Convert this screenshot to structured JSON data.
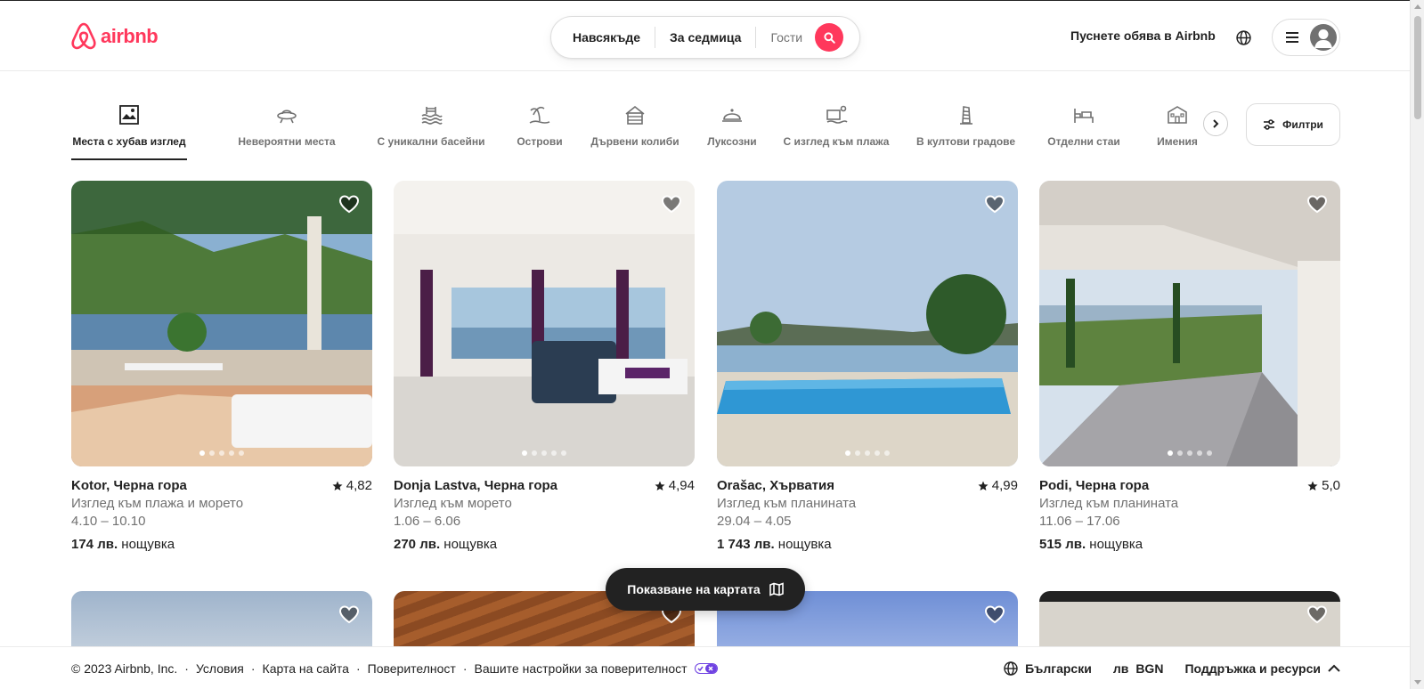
{
  "brand": {
    "name": "airbnb",
    "color": "#ff385c"
  },
  "search": {
    "where": "Навсякъде",
    "when": "За седмица",
    "guests_placeholder": "Гости",
    "button_icon": "search-icon"
  },
  "header": {
    "host_link": "Пуснете обява в Airbnb",
    "globe_icon": "globe-icon",
    "menu_icon": "hamburger-icon",
    "avatar_icon": "user-avatar-icon"
  },
  "categories": [
    {
      "label": "Места с хубав изглед",
      "icon": "picture-frame-icon",
      "active": true
    },
    {
      "label": "Невероятни места",
      "icon": "ufo-icon",
      "active": false
    },
    {
      "label": "С уникални басейни",
      "icon": "pool-icon",
      "active": false
    },
    {
      "label": "Острови",
      "icon": "island-icon",
      "active": false
    },
    {
      "label": "Дървени колиби",
      "icon": "cabin-icon",
      "active": false
    },
    {
      "label": "Луксозни",
      "icon": "luxe-icon",
      "active": false
    },
    {
      "label": "С изглед към плажа",
      "icon": "beach-view-icon",
      "active": false
    },
    {
      "label": "В култови градове",
      "icon": "landmark-icon",
      "active": false
    },
    {
      "label": "Отделни стаи",
      "icon": "bed-icon",
      "active": false
    },
    {
      "label": "Имения",
      "icon": "mansion-icon",
      "active": false
    }
  ],
  "filters_label": "Филтри",
  "listings": [
    {
      "location": "Kotor, Черна гора",
      "rating": "4,82",
      "subtitle": "Изглед към плажа и морето",
      "dates": "4.10 – 10.10",
      "price": "174 лв.",
      "price_unit": "нощувка",
      "photo_colors": [
        "#6f93b5",
        "#3e6b2c",
        "#c9b9a2"
      ]
    },
    {
      "location": "Donja Lastva, Черна гора",
      "rating": "4,94",
      "subtitle": "Изглед към морето",
      "dates": "1.06 – 6.06",
      "price": "270 лв.",
      "price_unit": "нощувка",
      "photo_colors": [
        "#e5e2dc",
        "#2f3f52",
        "#d7d2cb"
      ]
    },
    {
      "location": "Orašac, Хърватия",
      "rating": "4,99",
      "subtitle": "Изглед към планината",
      "dates": "29.04 – 4.05",
      "price": "1 743 лв.",
      "price_unit": "нощувка",
      "photo_colors": [
        "#a9c1dc",
        "#3a8fc9",
        "#d9d2c4"
      ]
    },
    {
      "location": "Podi, Черна гора",
      "rating": "5,0",
      "subtitle": "Изглед към планината",
      "dates": "11.06 – 17.06",
      "price": "515 лв.",
      "price_unit": "нощувка",
      "photo_colors": [
        "#cfdcea",
        "#55783b",
        "#8b8b8e"
      ]
    }
  ],
  "map_button": "Показване на картата",
  "footer": {
    "copyright": "© 2023 Airbnb, Inc.",
    "links": [
      "Условия",
      "Карта на сайта",
      "Поверителност",
      "Вашите настройки за поверителност"
    ],
    "language": "Български",
    "currency_symbol": "лв",
    "currency": "BGN",
    "support": "Поддръжка и ресурси"
  }
}
